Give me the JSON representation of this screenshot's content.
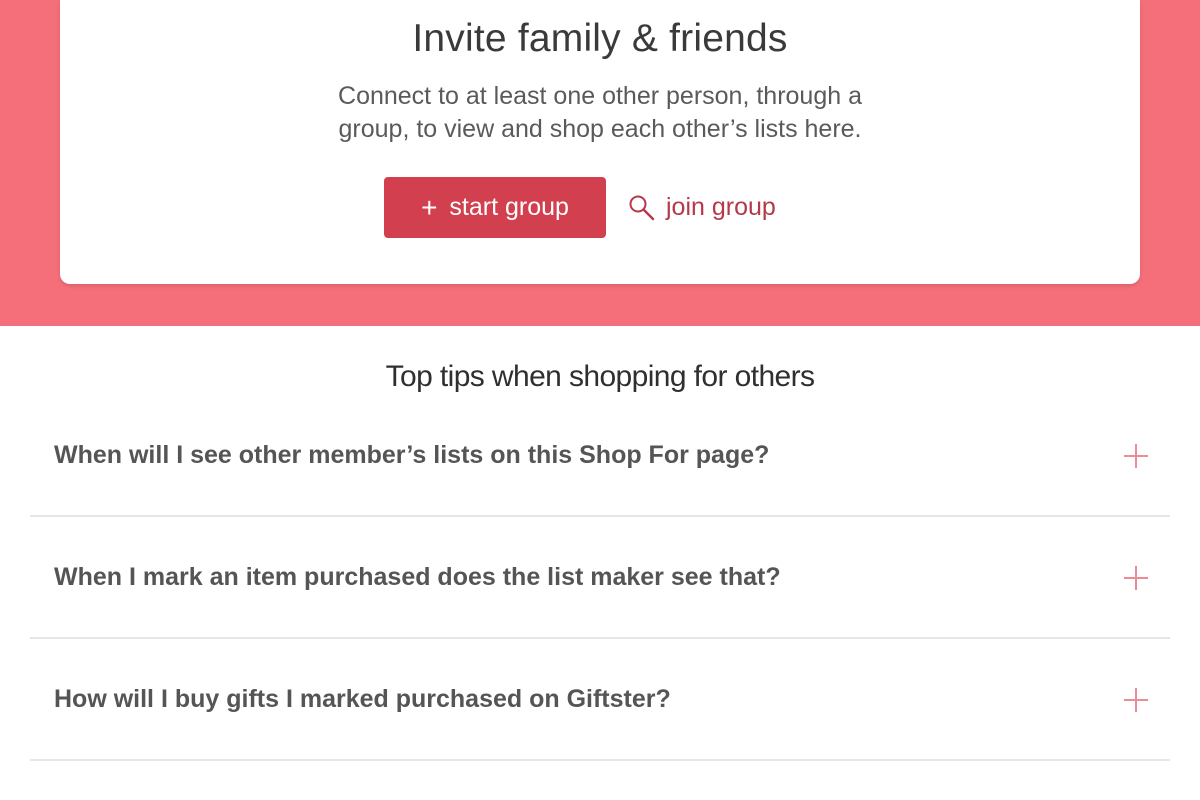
{
  "colors": {
    "hero_background": "#f56f7b",
    "primary_button": "#d2404f",
    "link": "#b5394a",
    "faq_toggle": "#f08a95"
  },
  "invite_card": {
    "title": "Invite family & friends",
    "subtitle": "Connect to at least one other person, through a group, to view and shop each other’s lists here.",
    "start_group": {
      "icon": "plus-icon",
      "label": "start group"
    },
    "join_group": {
      "icon": "search-icon",
      "label": "join group"
    }
  },
  "tips": {
    "title": "Top tips when shopping for others",
    "toggle_icon": "plus-icon",
    "items": [
      {
        "question": "When will I see other member’s lists on this Shop For page?"
      },
      {
        "question": "When I mark an item purchased does the list maker see that?"
      },
      {
        "question": "How will I buy gifts I marked purchased on Giftster?"
      }
    ]
  }
}
